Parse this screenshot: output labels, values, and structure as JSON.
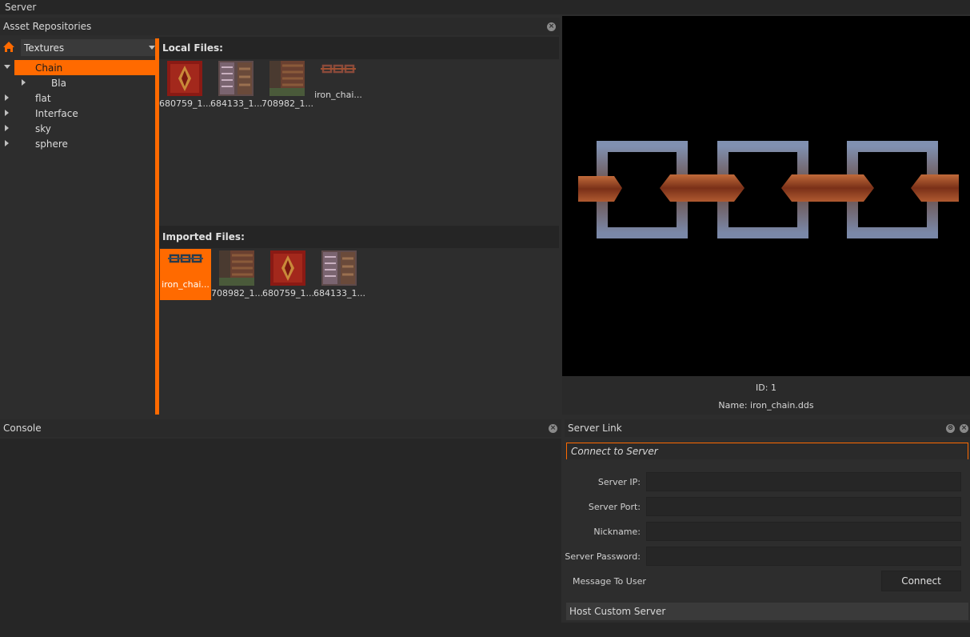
{
  "window": {
    "title": "Server"
  },
  "asset_panel": {
    "title": "Asset Repositories",
    "dropdown_value": "Textures",
    "tree": [
      {
        "label": "Chain",
        "expanded": true,
        "selected": true,
        "depth": 0
      },
      {
        "label": "Bla",
        "expanded": false,
        "selected": false,
        "depth": 1
      },
      {
        "label": "flat",
        "expanded": false,
        "selected": false,
        "depth": 0
      },
      {
        "label": "Interface",
        "expanded": false,
        "selected": false,
        "depth": 0
      },
      {
        "label": "sky",
        "expanded": false,
        "selected": false,
        "depth": 0
      },
      {
        "label": "sphere",
        "expanded": false,
        "selected": false,
        "depth": 0
      }
    ],
    "local_files_label": "Local Files:",
    "local_files": [
      "680759_1...",
      "684133_1...",
      "708982_1...",
      "iron_chai..."
    ],
    "imported_files_label": "Imported Files:",
    "imported_files": [
      "iron_chai...",
      "708982_1...",
      "680759_1...",
      "684133_1..."
    ]
  },
  "preview": {
    "id_text": "ID: 1",
    "name_text": "Name: iron_chain.dds"
  },
  "console": {
    "title": "Console"
  },
  "server_link": {
    "title": "Server Link",
    "connect_section": "Connect to Server",
    "fields": [
      {
        "label": "Server IP:",
        "value": ""
      },
      {
        "label": "Server Port:",
        "value": ""
      },
      {
        "label": "Nickname:",
        "value": ""
      },
      {
        "label": "Server Password:",
        "value": ""
      }
    ],
    "message_label": "Message To User",
    "connect_button": "Connect",
    "host_section": "Host Custom Server"
  },
  "colors": {
    "accent": "#ff6a00",
    "panel": "#2d2d2d",
    "dark": "#222222"
  }
}
